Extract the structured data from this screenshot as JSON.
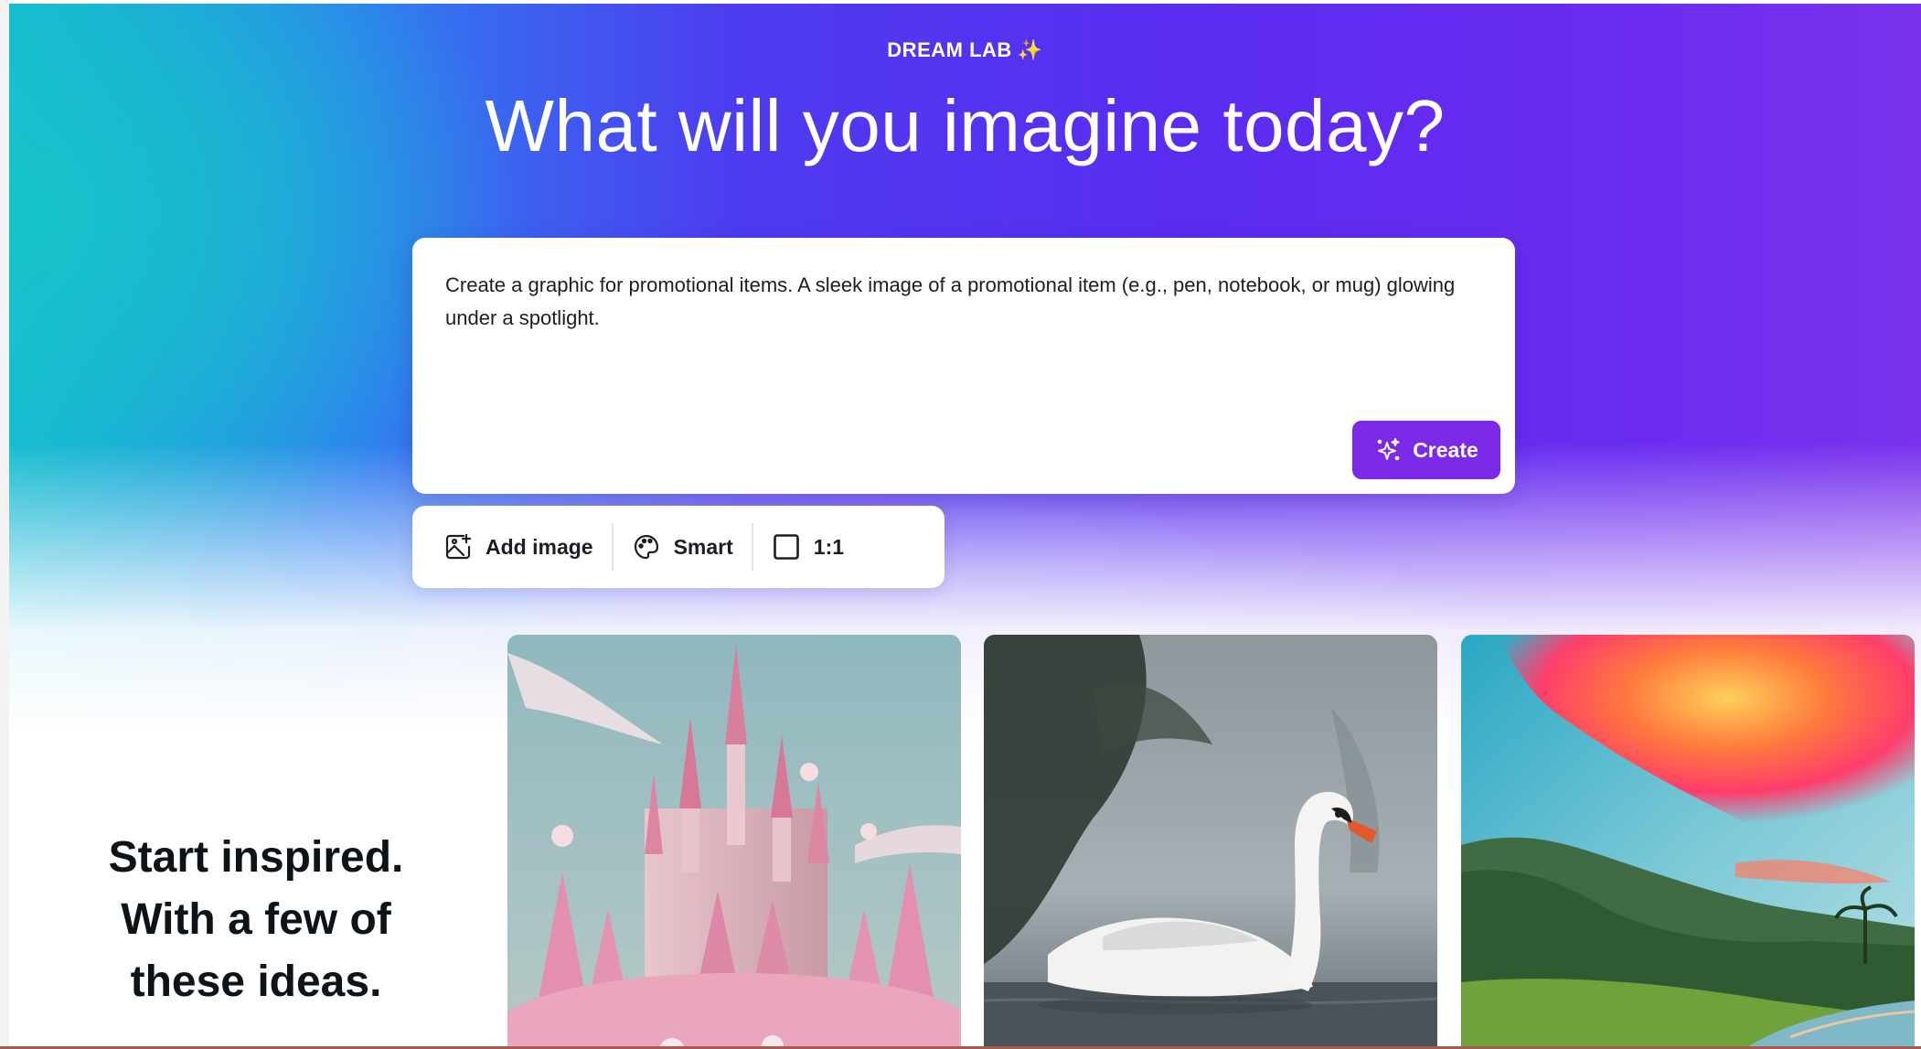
{
  "header": {
    "eyebrow": "DREAM LAB",
    "eyebrow_glyph": "✨",
    "title": "What will you imagine today?"
  },
  "prompt": {
    "value": "Create a graphic for promotional items. A sleek image of a promotional item (e.g., pen, notebook, or mug) glowing under a spotlight.",
    "create_label": "Create"
  },
  "toolbar": {
    "add_image_label": "Add image",
    "style_label": "Smart",
    "ratio_label": "1:1"
  },
  "inspiration": {
    "lines": [
      "Start inspired.",
      "With a few of",
      "these ideas."
    ],
    "tiles": [
      {
        "subject": "pink-castle"
      },
      {
        "subject": "white-swan"
      },
      {
        "subject": "sunset-valley"
      }
    ]
  },
  "colors": {
    "accent": "#7d2ae8",
    "hero_teal": "#16c3c9",
    "hero_purple": "#5a2cf0"
  }
}
